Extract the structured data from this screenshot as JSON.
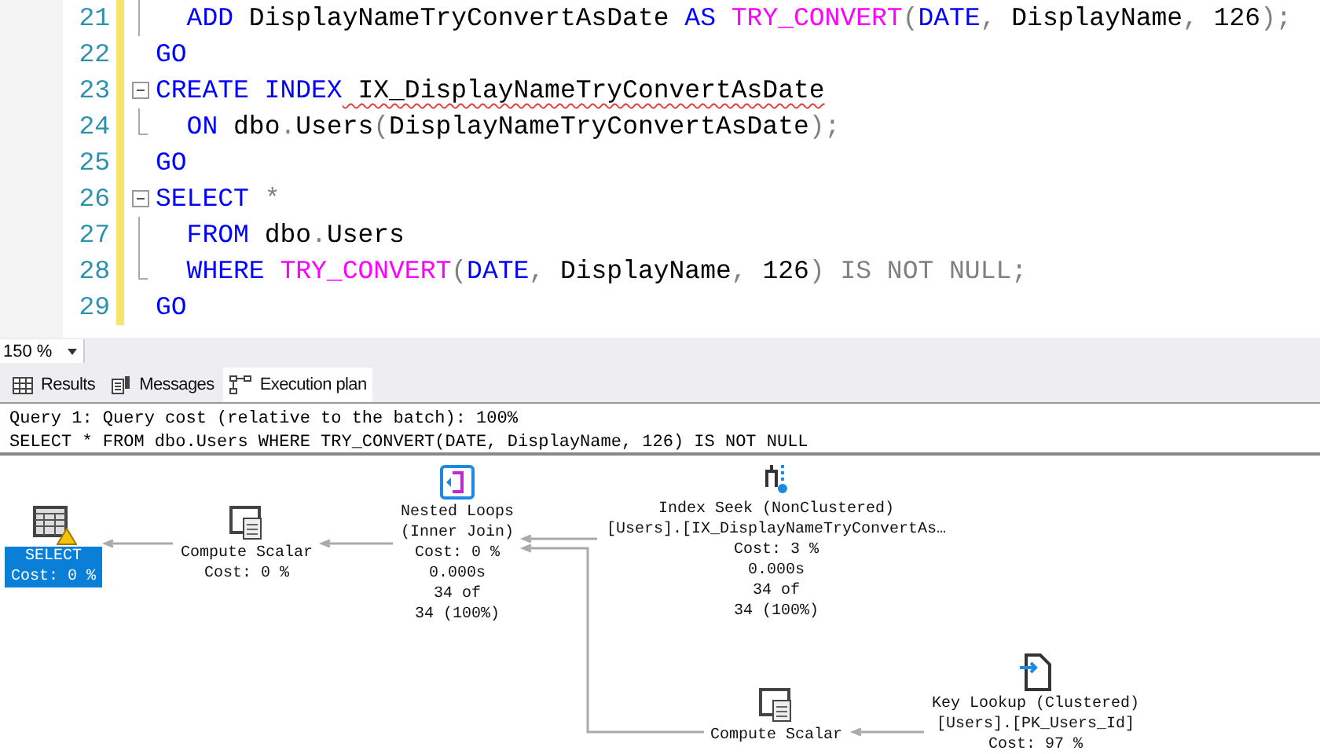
{
  "editor": {
    "lines": [
      {
        "number": "21",
        "in_block": true,
        "block_end": false,
        "tokens": [
          {
            "kind": "kw",
            "text": "  ADD"
          },
          {
            "kind": "plain",
            "text": " DisplayNameTryConvertAsDate "
          },
          {
            "kind": "kw",
            "text": "AS"
          },
          {
            "kind": "fn",
            "text": " TRY_CONVERT"
          },
          {
            "kind": "op",
            "text": "("
          },
          {
            "kind": "kw",
            "text": "DATE"
          },
          {
            "kind": "op",
            "text": ","
          },
          {
            "kind": "plain",
            "text": " DisplayName"
          },
          {
            "kind": "op",
            "text": ","
          },
          {
            "kind": "plain",
            "text": " 126"
          },
          {
            "kind": "op",
            "text": ");"
          }
        ]
      },
      {
        "number": "22",
        "tokens": [
          {
            "kind": "kw",
            "text": "GO"
          }
        ]
      },
      {
        "number": "23",
        "expanded": true,
        "tokens": [
          {
            "kind": "kw",
            "text": "CREATE INDEX"
          },
          {
            "kind": "error",
            "text": " IX_DisplayNameTryConvertAsDate"
          }
        ]
      },
      {
        "number": "24",
        "in_block": true,
        "block_end": true,
        "tokens": [
          {
            "kind": "kw",
            "text": "  ON"
          },
          {
            "kind": "plain",
            "text": " dbo"
          },
          {
            "kind": "op",
            "text": "."
          },
          {
            "kind": "plain",
            "text": "Users"
          },
          {
            "kind": "op",
            "text": "("
          },
          {
            "kind": "plain",
            "text": "DisplayNameTryConvertAsDate"
          },
          {
            "kind": "op",
            "text": ");"
          }
        ]
      },
      {
        "number": "25",
        "tokens": [
          {
            "kind": "kw",
            "text": "GO"
          }
        ]
      },
      {
        "number": "26",
        "expanded": true,
        "tokens": [
          {
            "kind": "kw",
            "text": "SELECT"
          },
          {
            "kind": "op",
            "text": " *"
          }
        ]
      },
      {
        "number": "27",
        "in_block": true,
        "block_end": false,
        "tokens": [
          {
            "kind": "kw",
            "text": "  FROM"
          },
          {
            "kind": "plain",
            "text": " dbo"
          },
          {
            "kind": "op",
            "text": "."
          },
          {
            "kind": "plain",
            "text": "Users"
          }
        ]
      },
      {
        "number": "28",
        "in_block": true,
        "block_end": true,
        "tokens": [
          {
            "kind": "kw",
            "text": "  WHERE"
          },
          {
            "kind": "fn",
            "text": " TRY_CONVERT"
          },
          {
            "kind": "op",
            "text": "("
          },
          {
            "kind": "kw",
            "text": "DATE"
          },
          {
            "kind": "op",
            "text": ","
          },
          {
            "kind": "plain",
            "text": " DisplayName"
          },
          {
            "kind": "op",
            "text": ","
          },
          {
            "kind": "plain",
            "text": " 126"
          },
          {
            "kind": "op",
            "text": ") IS NOT NULL;"
          }
        ]
      },
      {
        "number": "29",
        "tokens": [
          {
            "kind": "kw",
            "text": "GO"
          }
        ]
      }
    ]
  },
  "zoom": {
    "value": "150 %"
  },
  "tabs": [
    {
      "label": "Results",
      "selected": false
    },
    {
      "label": "Messages",
      "selected": false
    },
    {
      "label": "Execution plan",
      "selected": true
    }
  ],
  "query_header": [
    "Query 1: Query cost (relative to the batch): 100%",
    "SELECT * FROM dbo.Users WHERE TRY_CONVERT(DATE, DisplayName, 126) IS NOT NULL"
  ],
  "plan": {
    "nodes": [
      {
        "kind": "select",
        "selected": true,
        "warning": true,
        "lines": [
          "SELECT",
          "Cost: 0 %"
        ]
      },
      {
        "kind": "compute_scalar",
        "selected": false,
        "warning": false,
        "lines": [
          "Compute Scalar",
          "Cost: 0 %"
        ]
      },
      {
        "kind": "nested_loops",
        "selected": false,
        "warning": false,
        "lines": [
          "Nested Loops",
          "(Inner Join)",
          "Cost: 0 %",
          "0.000s",
          "34 of",
          "34 (100%)"
        ]
      },
      {
        "kind": "index_seek",
        "selected": false,
        "warning": false,
        "lines": [
          "Index Seek (NonClustered)",
          "[Users].[IX_DisplayNameTryConvertAs…",
          "Cost: 3 %",
          "0.000s",
          "34 of",
          "34 (100%)"
        ]
      },
      {
        "kind": "compute_scalar",
        "selected": false,
        "warning": false,
        "lines": [
          "Compute Scalar"
        ]
      },
      {
        "kind": "key_lookup",
        "selected": false,
        "warning": false,
        "lines": [
          "Key Lookup (Clustered)",
          "[Users].[PK_Users_Id]",
          "Cost: 97 %"
        ]
      }
    ]
  }
}
